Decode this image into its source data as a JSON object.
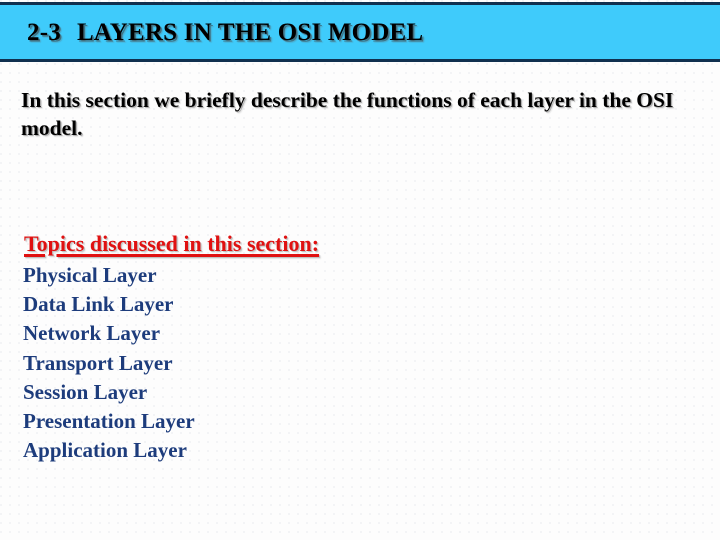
{
  "slide": {
    "header": {
      "section_number": "2-3",
      "title": "LAYERS IN THE OSI MODEL",
      "background_color": "#3fcbfb",
      "border_color": "#10304f",
      "text_color": "#000000"
    },
    "intro": {
      "text": "In this section we briefly describe the functions of each layer in the OSI model.",
      "text_color": "#000000"
    },
    "topics": {
      "heading": "Topics discussed in this section:",
      "heading_color": "#e01111",
      "item_color": "#1d3c7c",
      "items": [
        {
          "label": "Physical Layer"
        },
        {
          "label": "Data Link Layer"
        },
        {
          "label": "Network Layer"
        },
        {
          "label": "Transport Layer"
        },
        {
          "label": "Session Layer"
        },
        {
          "label": "Presentation Layer"
        },
        {
          "label": "Application Layer"
        }
      ]
    }
  }
}
